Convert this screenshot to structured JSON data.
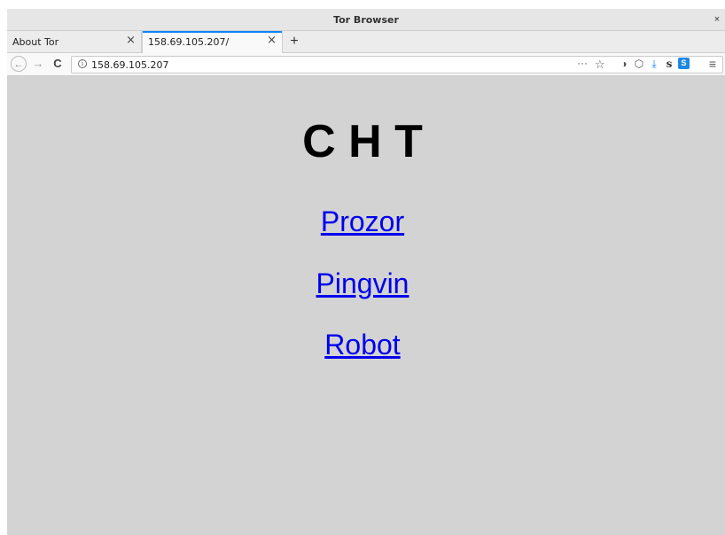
{
  "window": {
    "title": "Tor Browser",
    "close_symbol": "×"
  },
  "tabs": [
    {
      "label": "About Tor",
      "close_symbol": "×",
      "active": false
    },
    {
      "label": "158.69.105.207/",
      "close_symbol": "×",
      "active": true
    }
  ],
  "newtab_symbol": "+",
  "nav": {
    "back_symbol": "←",
    "forward_symbol": "→",
    "reload_symbol": "C"
  },
  "urlbar": {
    "info_symbol": "i",
    "url": "158.69.105.207",
    "more_symbol": "···",
    "star_symbol": "☆"
  },
  "toolbar_icons": {
    "onion": "◑",
    "shield": "⬡",
    "download": "⤓",
    "s_ext": "s",
    "ext": "S",
    "menu": "≡"
  },
  "page": {
    "heading": "C H T",
    "links": [
      "Prozor",
      "Pingvin",
      "Robot"
    ]
  },
  "colors": {
    "background": "#d3d3d3",
    "link": "#0000ee",
    "tab_accent": "#0a84ff"
  }
}
